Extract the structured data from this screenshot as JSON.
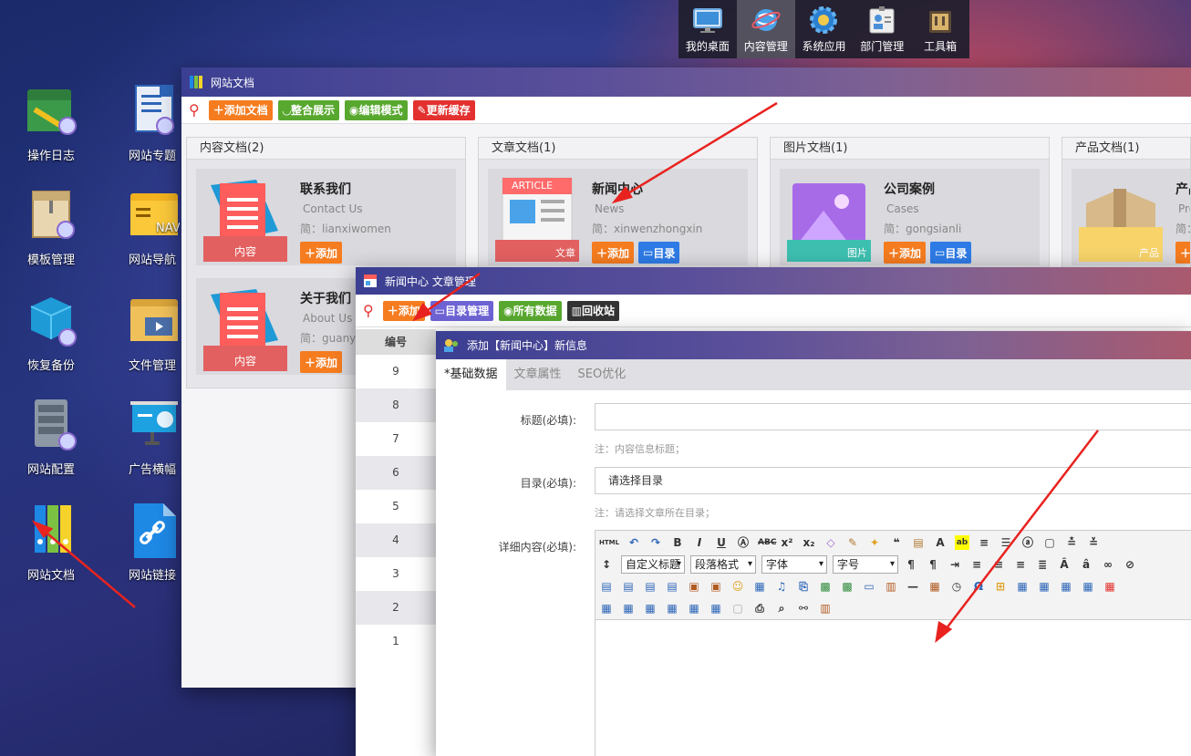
{
  "taskbar": {
    "items": [
      {
        "label": "我的桌面",
        "icon": "monitor-icon"
      },
      {
        "label": "内容管理",
        "icon": "globe-icon",
        "active": true
      },
      {
        "label": "系统应用",
        "icon": "gear-icon"
      },
      {
        "label": "部门管理",
        "icon": "id-badge-icon"
      },
      {
        "label": "工具箱",
        "icon": "toolbox-icon"
      }
    ]
  },
  "desktop": {
    "icons": [
      {
        "label": "操作日志",
        "icon": "folder-log-icon"
      },
      {
        "label": "网站专题",
        "icon": "document-globe-icon"
      },
      {
        "label": "模板管理",
        "icon": "template-box-icon"
      },
      {
        "label": "网站导航",
        "icon": "nav-folder-icon"
      },
      {
        "label": "恢复备份",
        "icon": "backup-cube-icon"
      },
      {
        "label": "文件管理",
        "icon": "file-folder-icon"
      },
      {
        "label": "网站配置",
        "icon": "server-icon"
      },
      {
        "label": "广告横幅",
        "icon": "banner-icon"
      },
      {
        "label": "网站文档",
        "icon": "binders-icon"
      },
      {
        "label": "网站链接",
        "icon": "link-file-icon"
      }
    ]
  },
  "docs_window": {
    "title": "网站文档",
    "toolbar": {
      "add": "添加文档",
      "integrate": "整合展示",
      "edit_mode": "编辑模式",
      "refresh_cache": "更新缓存"
    },
    "panels": [
      {
        "title": "内容文档(2)",
        "cards": [
          {
            "title": "联系我们",
            "subtitle": "Contact Us",
            "pinyin": "简：lianxiwomen",
            "badge": "内容",
            "add": "添加"
          },
          {
            "title": "关于我们",
            "subtitle": "About Us",
            "pinyin": "简：guanyu",
            "badge": "内容",
            "add": "添加"
          }
        ]
      },
      {
        "title": "文章文档(1)",
        "cards": [
          {
            "title": "新闻中心",
            "subtitle": "News",
            "pinyin": "简：xinwenzhongxin",
            "badge": "文章",
            "add": "添加",
            "dir": "目录",
            "art": "ARTICLE"
          }
        ]
      },
      {
        "title": "图片文档(1)",
        "cards": [
          {
            "title": "公司案例",
            "subtitle": "Cases",
            "pinyin": "简：gongsianli",
            "badge": "图片",
            "add": "添加",
            "dir": "目录"
          }
        ]
      },
      {
        "title": "产品文档(1)",
        "cards": [
          {
            "title": "产品",
            "subtitle": "Pro",
            "pinyin": "简：",
            "badge": "产品",
            "add": "添加"
          }
        ]
      }
    ]
  },
  "news_window": {
    "title": "新闻中心 文章管理",
    "toolbar": {
      "add": "添加",
      "dir_manage": "目录管理",
      "all_data": "所有数据",
      "recycle": "回收站"
    },
    "list_header": "编号",
    "ids": [
      "9",
      "8",
      "7",
      "6",
      "5",
      "4",
      "3",
      "2",
      "1"
    ]
  },
  "add_window": {
    "title": "添加【新闻中心】新信息",
    "tabs": [
      "*基础数据",
      "文章属性",
      "SEO优化"
    ],
    "fields": {
      "title_label": "标题(必填):",
      "title_value": "",
      "title_note": "注：内容信息标题；",
      "dir_label": "目录(必填):",
      "dir_value": "请选择目录",
      "dir_note": "注：请选择文章所在目录；",
      "content_label": "详细内容(必填):"
    },
    "editor": {
      "html_btn": "HTML",
      "selects": [
        "自定义标题",
        "段落格式",
        "字体",
        "字号"
      ]
    }
  },
  "colors": {
    "accent_orange": "#f57c1f",
    "accent_green": "#58a82f",
    "accent_red": "#e2312f",
    "accent_blue": "#2e7be6",
    "arrow_red": "#e8231f"
  }
}
